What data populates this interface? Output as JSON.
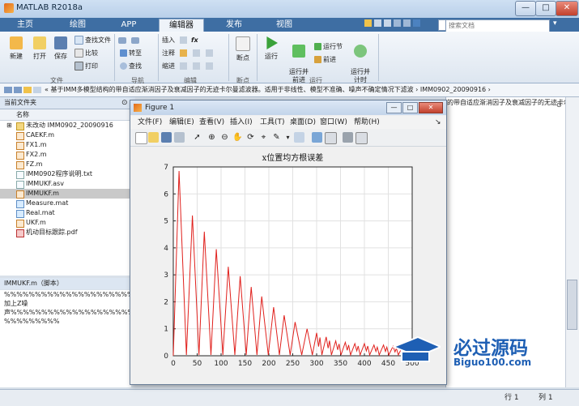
{
  "window": {
    "title": "MATLAB R2018a",
    "min": "—",
    "max": "□",
    "close": "✕"
  },
  "ribbon_tabs": [
    "主页",
    "绘图",
    "APP",
    "编辑器",
    "发布",
    "视图"
  ],
  "search_placeholder": "搜索文档",
  "ribbon": {
    "file_group": {
      "label": "文件",
      "new": "新建",
      "open": "打开",
      "save": "保存",
      "find_files": "查找文件",
      "compare": "比较",
      "print": "打印"
    },
    "nav_group": {
      "label": "导航",
      "goto": "转至",
      "find": "查找"
    },
    "edit_group": {
      "label": "编辑",
      "insert": "插入",
      "comment": "注释",
      "indent": "缩进",
      "fx": "fx"
    },
    "bp_group": {
      "label": "断点",
      "breakpoints": "断点"
    },
    "run_group": {
      "label": "运行",
      "run": "运行",
      "run_advance": "运行并\n前进",
      "run_section": "运行节",
      "advance": "前进",
      "run_time": "运行并\n计时"
    }
  },
  "address_path": "« 基于IMM多模型结构的带自适应渐消因子及衰减因子的无迹卡尔曼滤波器。适用于非线性、模型不准确、噪声不确定情况下滤波  › IMM0902_20090916  ›",
  "current_folder": {
    "title": "当前文件夹",
    "column": "名称",
    "files": [
      {
        "name": "未改动 IMM0902_20090916",
        "type": "dir",
        "selected": false
      },
      {
        "name": "CAEKF.m",
        "type": "m",
        "selected": false
      },
      {
        "name": "FX1.m",
        "type": "m",
        "selected": false
      },
      {
        "name": "FX2.m",
        "type": "m",
        "selected": false
      },
      {
        "name": "FZ.m",
        "type": "m",
        "selected": false
      },
      {
        "name": "IMM0902程序说明.txt",
        "type": "txt",
        "selected": false
      },
      {
        "name": "IMMUKF.asv",
        "type": "txt",
        "selected": false
      },
      {
        "name": "IMMUKF.m",
        "type": "m",
        "selected": true
      },
      {
        "name": "Measure.mat",
        "type": "mat",
        "selected": false
      },
      {
        "name": "Real.mat",
        "type": "mat",
        "selected": false
      },
      {
        "name": "UKF.m",
        "type": "m",
        "selected": false
      },
      {
        "name": "机动目标跟踪.pdf",
        "type": "pdf",
        "selected": false
      }
    ]
  },
  "details": {
    "title": "IMMUKF.m（脚本）",
    "lines": [
      "%%%%%%%%%%%%%%%%%%%%%%%",
      "加上Z噪",
      "声%%%%%%%%%%%%%%%%%%%%%",
      "%%%%%%%%%"
    ]
  },
  "right_panel_text": "的带自适应渐消因子及衰减因子的无迹卡尔…",
  "status": {
    "position": "行 1",
    "col": "列 1"
  },
  "figure": {
    "title": "Figure 1",
    "menu": [
      "文件(F)",
      "编辑(E)",
      "查看(V)",
      "插入(I)",
      "工具(T)",
      "桌面(D)",
      "窗口(W)",
      "帮助(H)"
    ]
  },
  "chart_data": {
    "type": "line",
    "title": "x位置均方根误差",
    "xlabel": "",
    "ylabel": "",
    "xlim": [
      0,
      500
    ],
    "ylim": [
      0,
      7
    ],
    "xticks": [
      0,
      50,
      100,
      150,
      200,
      250,
      300,
      350,
      400,
      450,
      500
    ],
    "yticks": [
      0,
      1,
      2,
      3,
      4,
      5,
      6,
      7
    ],
    "grid": true,
    "series": [
      {
        "color": "#e0201c",
        "peaks": [
          {
            "x": 12,
            "y": 6.85
          },
          {
            "x": 40,
            "y": 5.2
          },
          {
            "x": 65,
            "y": 4.6
          },
          {
            "x": 90,
            "y": 3.95
          },
          {
            "x": 115,
            "y": 3.3
          },
          {
            "x": 140,
            "y": 2.95
          },
          {
            "x": 163,
            "y": 2.55
          },
          {
            "x": 185,
            "y": 2.2
          },
          {
            "x": 210,
            "y": 1.8
          },
          {
            "x": 232,
            "y": 1.5
          },
          {
            "x": 255,
            "y": 1.25
          },
          {
            "x": 280,
            "y": 1.0
          },
          {
            "x": 300,
            "y": 0.85
          },
          {
            "x": 320,
            "y": 0.7
          },
          {
            "x": 340,
            "y": 0.55
          },
          {
            "x": 360,
            "y": 0.5
          },
          {
            "x": 380,
            "y": 0.45
          },
          {
            "x": 400,
            "y": 0.45
          },
          {
            "x": 420,
            "y": 0.4
          },
          {
            "x": 440,
            "y": 0.4
          },
          {
            "x": 460,
            "y": 0.35
          },
          {
            "x": 480,
            "y": 0.35
          },
          {
            "x": 498,
            "y": 0.3
          }
        ]
      }
    ]
  },
  "watermark": {
    "cn": "必过源码",
    "en": "Biguo100.com"
  }
}
